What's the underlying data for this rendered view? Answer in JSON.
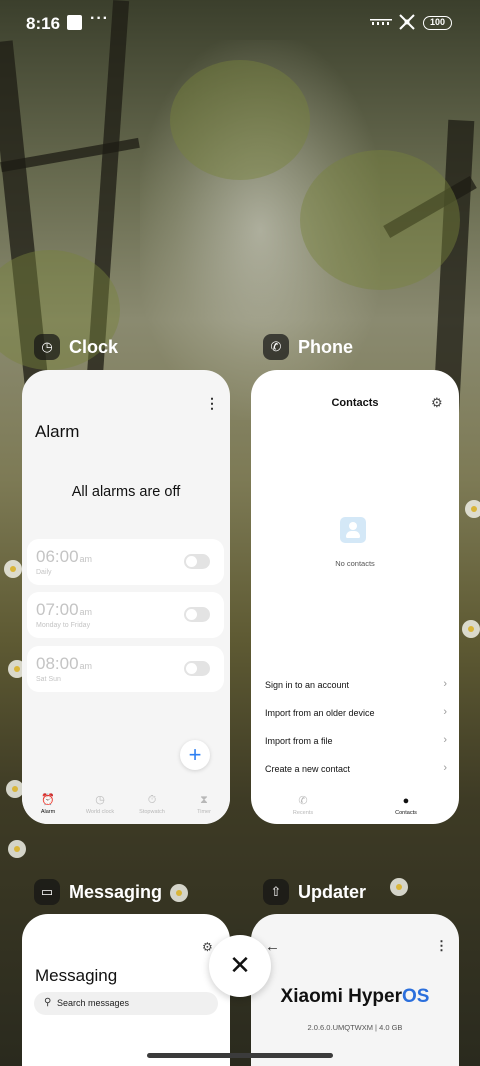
{
  "status_bar": {
    "time": "8:16",
    "dots": "···",
    "signal": "Ⓛ..",
    "battery": "100"
  },
  "recents": {
    "clock": {
      "app_name": "Clock",
      "title": "Alarm",
      "empty_message": "All alarms are off",
      "alarms": [
        {
          "time": "06:00",
          "ampm": "am",
          "days": "Daily",
          "enabled": false
        },
        {
          "time": "07:00",
          "ampm": "am",
          "days": "Monday to Friday",
          "enabled": false
        },
        {
          "time": "08:00",
          "ampm": "am",
          "days": "Sat Sun",
          "enabled": false
        }
      ],
      "nav": [
        {
          "label": "Alarm",
          "icon": "alarm-icon",
          "active": true
        },
        {
          "label": "World clock",
          "icon": "world-clock-icon",
          "active": false
        },
        {
          "label": "Stopwatch",
          "icon": "stopwatch-icon",
          "active": false
        },
        {
          "label": "Timer",
          "icon": "timer-icon",
          "active": false
        }
      ]
    },
    "phone": {
      "app_name": "Phone",
      "title": "Contacts",
      "empty_message": "No contacts",
      "options": [
        "Sign in to an account",
        "Import from an older device",
        "Import from a file",
        "Create a new contact"
      ],
      "nav": [
        {
          "label": "Recents",
          "icon": "phone-icon",
          "active": false
        },
        {
          "label": "Contacts",
          "icon": "person-icon",
          "active": true
        }
      ]
    },
    "messaging": {
      "app_name": "Messaging",
      "title": "Messaging",
      "search_placeholder": "Search messages"
    },
    "updater": {
      "app_name": "Updater",
      "brand_prefix": "Xiaomi Hyper",
      "brand_suffix": "OS",
      "version": "2.0.6.0.UMQTWXM | 4.0 GB"
    }
  },
  "colors": {
    "accent_blue": "#2d7ff2",
    "hyperos_blue": "#2b6fdc"
  }
}
